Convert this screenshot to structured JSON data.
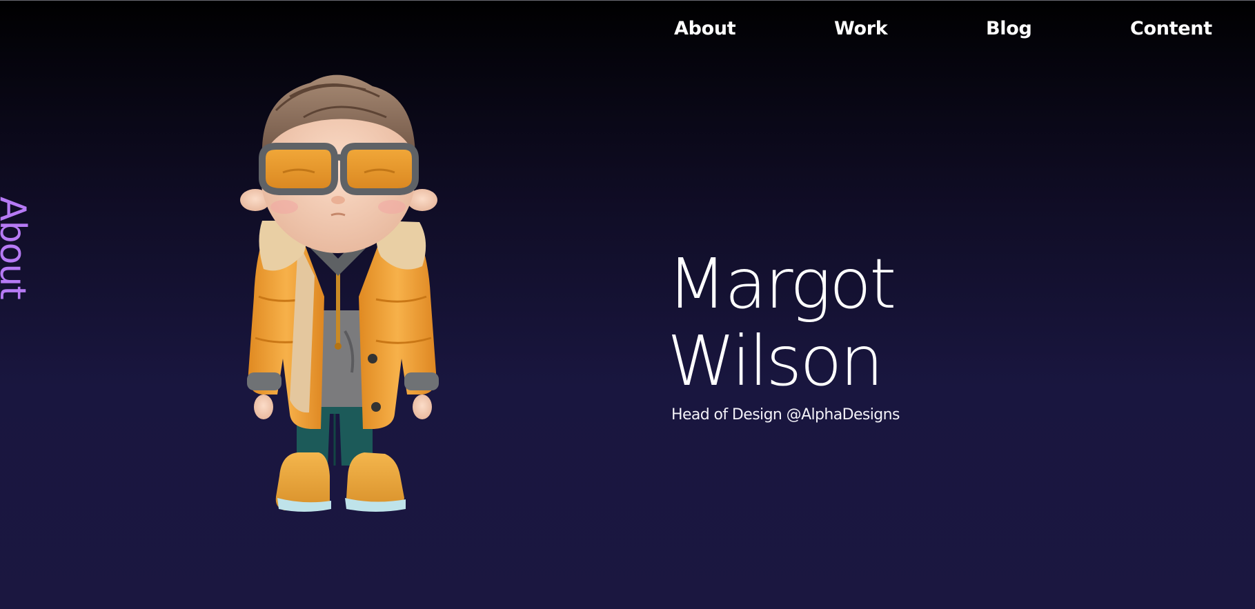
{
  "nav": {
    "items": [
      {
        "label": "About"
      },
      {
        "label": "Work"
      },
      {
        "label": "Blog"
      },
      {
        "label": "Content"
      }
    ]
  },
  "side": {
    "label": "About"
  },
  "hero": {
    "first_name": "Margot",
    "last_name": "Wilson",
    "subtitle": "Head of Design @AlphaDesigns"
  },
  "avatar": {
    "icon": "avatar-illustration"
  },
  "colors": {
    "accent": "#b67af4",
    "background_top": "#000000",
    "background_bottom": "#1b1740",
    "jacket": "#f2a33a",
    "text": "#ffffff"
  }
}
